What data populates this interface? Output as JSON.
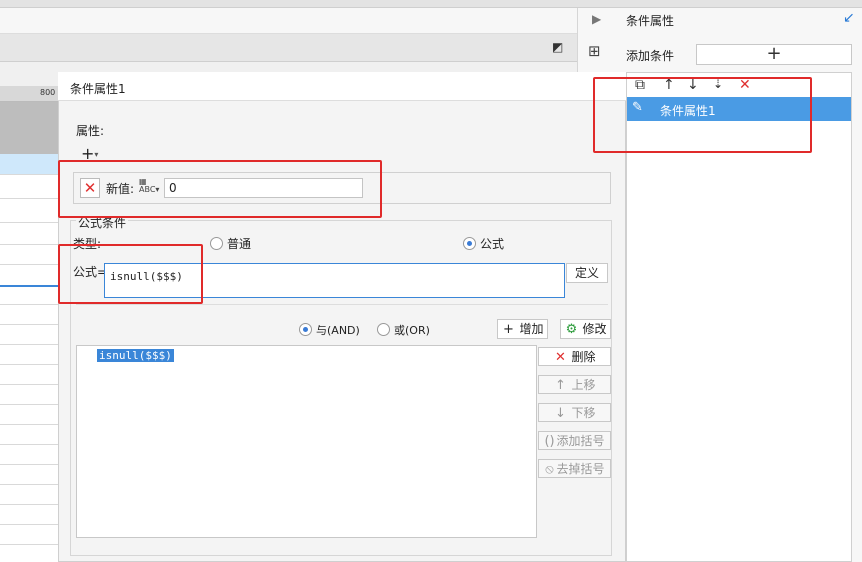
{
  "panel": {
    "title": "条件属性",
    "add_label": "添加条件",
    "add_symbol": "+",
    "toolbar": [
      "copy-icon",
      "arrow-up-icon",
      "arrow-down-icon",
      "sort-down-icon",
      "delete-icon"
    ],
    "items": [
      {
        "label": "条件属性1",
        "selected": true
      }
    ]
  },
  "background": {
    "ruler_label": "800"
  },
  "dialog": {
    "title": "条件属性1",
    "attribute_label": "属性:",
    "add_symbol": "+",
    "new_value_label": "新值:",
    "new_value": "0",
    "formula_group_label": "公式条件",
    "type_label": "类型:",
    "type_options": [
      {
        "label": "普通",
        "selected": false
      },
      {
        "label": "公式",
        "selected": true
      }
    ],
    "formula_label": "公式=",
    "formula_value": "isnull($$$)",
    "define_button": "定义",
    "logic_options": [
      {
        "label": "与(AND)",
        "selected": true
      },
      {
        "label": "或(OR)",
        "selected": false
      }
    ],
    "add_button": "增加",
    "modify_button": "修改",
    "conditions": [
      "isnull($$$)"
    ],
    "side_buttons": [
      {
        "label": "删除",
        "enabled": true
      },
      {
        "label": "上移",
        "enabled": false
      },
      {
        "label": "下移",
        "enabled": false
      },
      {
        "label": "添加括号",
        "enabled": false
      },
      {
        "label": "去掉括号",
        "enabled": false
      }
    ]
  },
  "colors": {
    "accent": "#3a86d8",
    "selection": "#4a9be4",
    "highlight_box": "#e02a2a",
    "delete": "#e03030"
  }
}
